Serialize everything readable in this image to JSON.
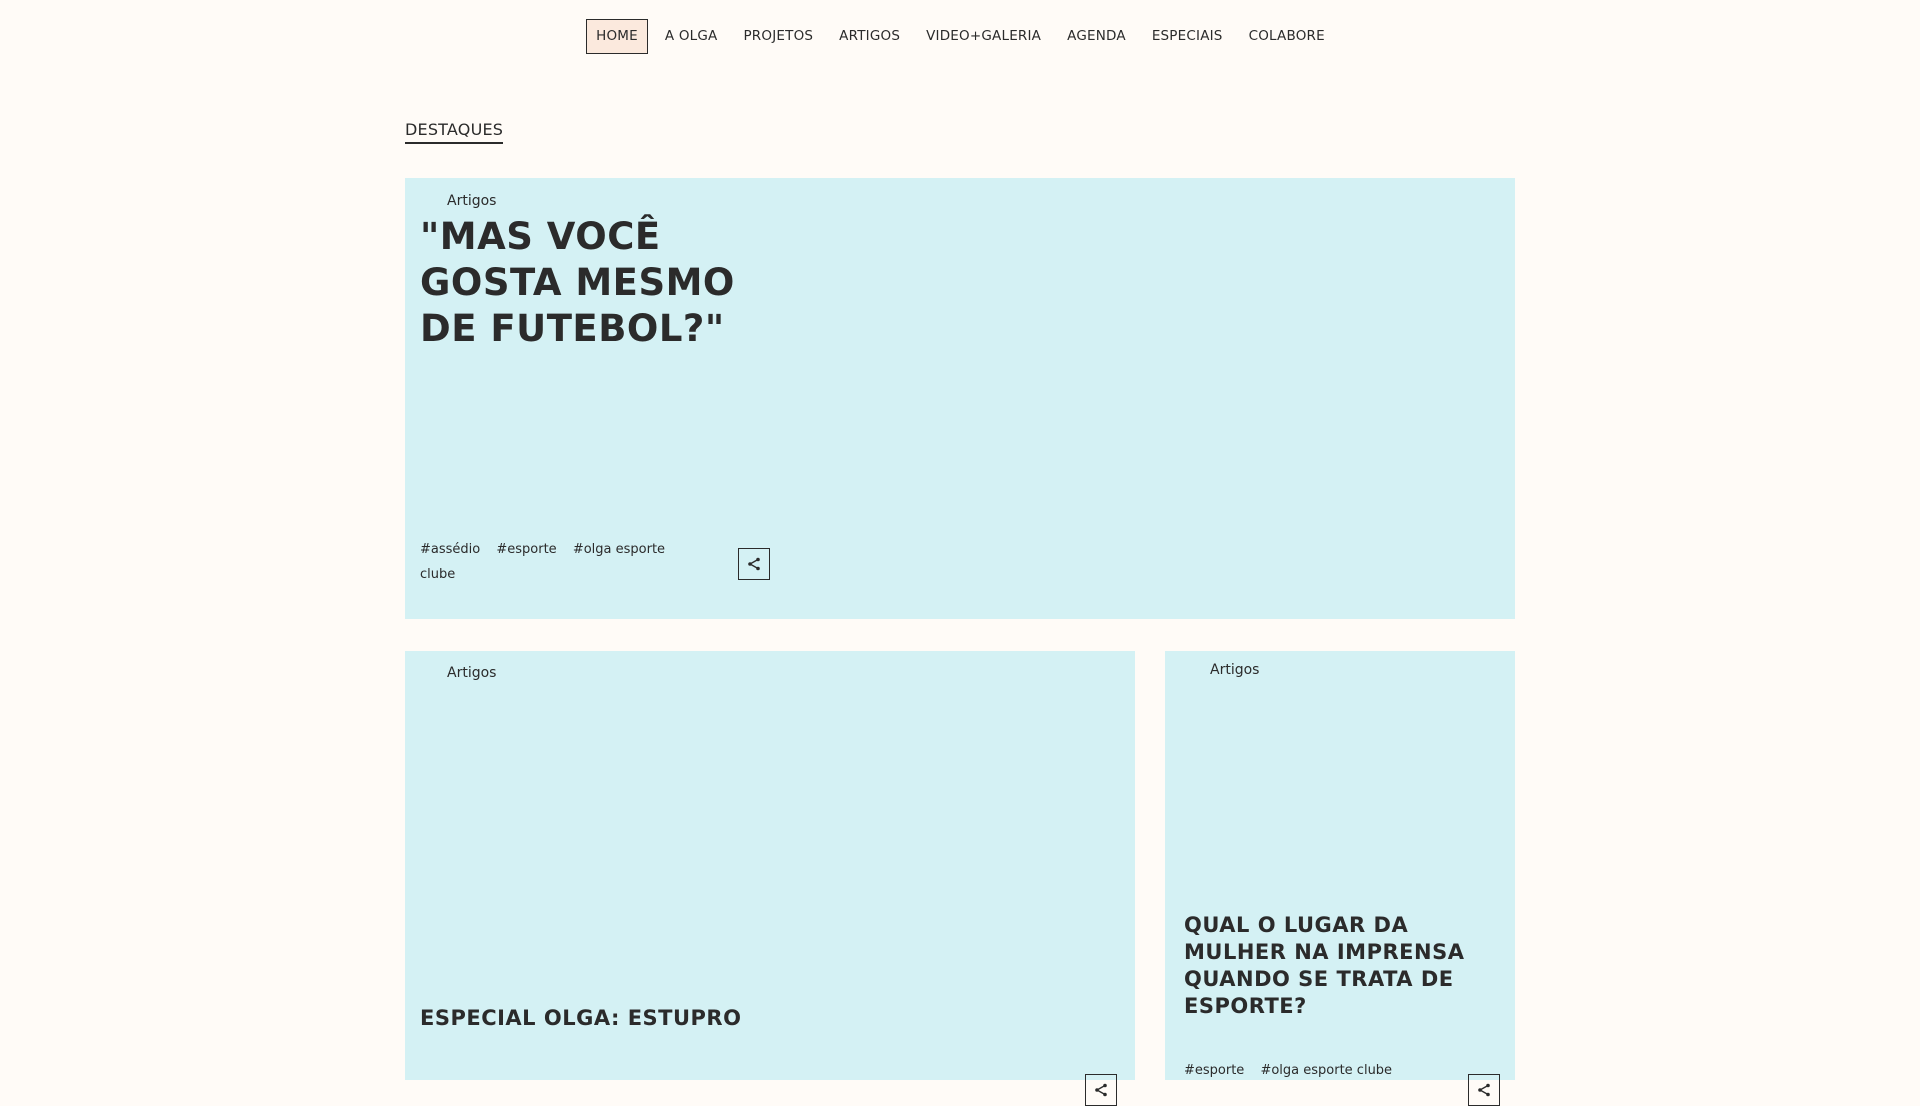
{
  "nav": {
    "items": [
      {
        "label": "HOME"
      },
      {
        "label": "A OLGA"
      },
      {
        "label": "PROJETOS"
      },
      {
        "label": "ARTIGOS"
      },
      {
        "label": "VIDEO+GALERIA"
      },
      {
        "label": "AGENDA"
      },
      {
        "label": "ESPECIAIS"
      },
      {
        "label": "COLABORE"
      }
    ],
    "active_index": 0
  },
  "section": {
    "title": "DESTAQUES"
  },
  "featured": {
    "category": "Artigos",
    "title": "\"MAS VOCÊ GOSTA MESMO DE FUTEBOL?\"",
    "tags": [
      "#assédio",
      "#esporte",
      "#olga esporte clube"
    ],
    "share_icon": "share-icon"
  },
  "card_left": {
    "category": "Artigos",
    "title": "ESPECIAL OLGA: ESTUPRO",
    "share_icon": "share-icon"
  },
  "card_right": {
    "category": "Artigos",
    "title": "QUAL O LUGAR DA MULHER NA IMPRENSA QUANDO SE TRATA DE ESPORTE?",
    "tags": [
      "#esporte",
      "#olga esporte clube"
    ],
    "share_icon": "share-icon"
  },
  "colors": {
    "background": "#fffbf7",
    "card": "#d4f1f4",
    "active_nav": "#fbe9dd",
    "text": "#2b2b2b"
  }
}
